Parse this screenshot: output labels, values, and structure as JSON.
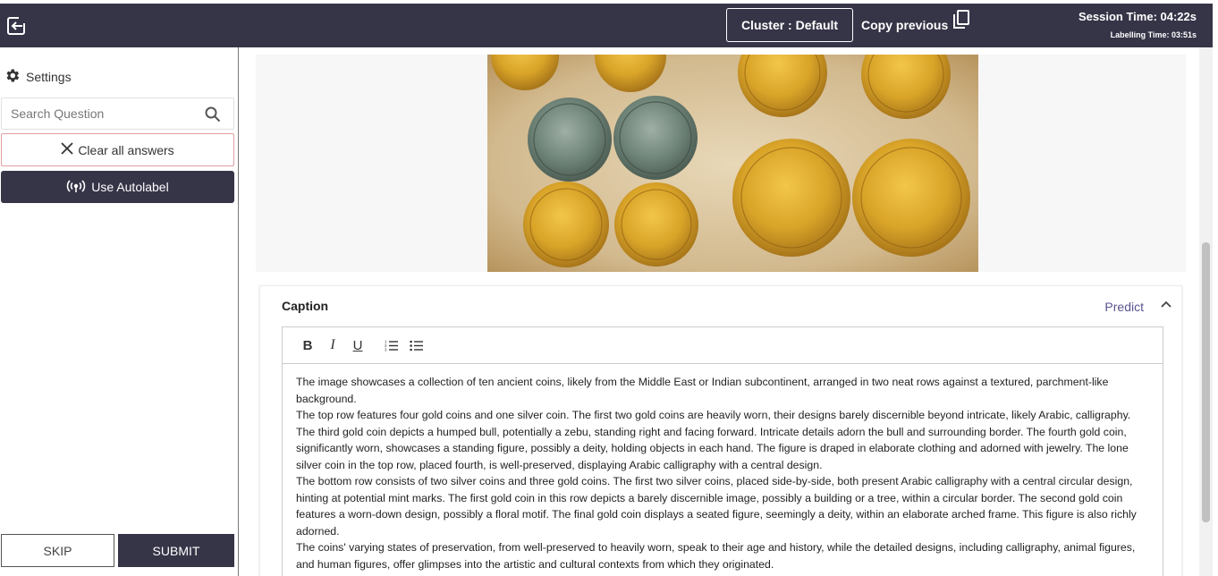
{
  "header": {
    "cluster_label": "Cluster : Default",
    "copy_previous_label": "Copy previous",
    "session_time": "Session Time: 04:22s",
    "labelling_time": "Labelling Time: 03:51s",
    "background_color": "#363447"
  },
  "sidebar": {
    "settings_label": "Settings",
    "search_placeholder": "Search Question",
    "clear_label": "Clear all answers",
    "autolabel_label": "Use Autolabel",
    "skip_label": "SKIP",
    "submit_label": "SUBMIT"
  },
  "caption": {
    "title": "Caption",
    "predict_label": "Predict",
    "toolbar": {
      "bold": "B",
      "italic": "I",
      "underline": "U"
    },
    "paragraphs": [
      "The image showcases a collection of ten ancient coins, likely from the Middle East or Indian subcontinent, arranged in two neat rows against a textured, parchment-like background.",
      "The top row features four gold coins and one silver coin. The first two gold coins are heavily worn, their designs barely discernible beyond intricate, likely Arabic, calligraphy. The third gold coin depicts a humped bull, potentially a zebu, standing right and facing forward. Intricate details adorn the bull and surrounding border. The fourth gold coin, significantly worn, showcases a standing figure, possibly a deity, holding objects in each hand. The figure is draped in elaborate clothing and adorned with jewelry. The lone silver coin in the top row, placed fourth, is well-preserved, displaying Arabic calligraphy with a central design.",
      "The bottom row consists of two silver coins and three gold coins. The first two silver coins, placed side-by-side, both present Arabic calligraphy with a central circular design, hinting at potential mint marks. The first gold coin in this row depicts a barely discernible image, possibly a building or a tree, within a circular border. The second gold coin features a worn-down design, possibly a floral motif. The final gold coin displays a seated figure, seemingly a deity, within an elaborate arched frame. This figure is also richly adorned.",
      "The coins' varying states of preservation, from well-preserved to heavily worn, speak to their age and history, while the detailed designs, including calligraphy, animal figures, and human figures, offer glimpses into the artistic and cultural contexts from which they originated."
    ]
  },
  "colors": {
    "accent": "#363447",
    "link": "#5a5490",
    "clear_border": "#e0a0a0"
  }
}
